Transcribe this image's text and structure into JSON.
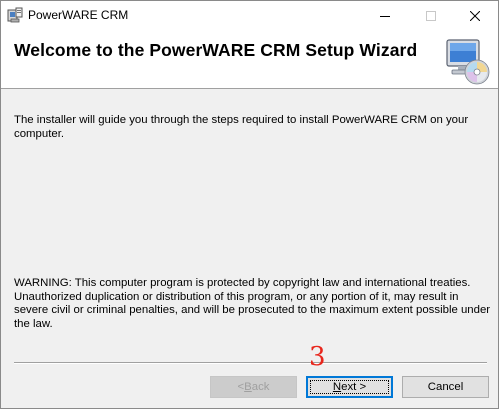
{
  "window": {
    "title": "PowerWARE CRM"
  },
  "banner": {
    "title": "Welcome to the PowerWARE CRM Setup Wizard",
    "icon": "computer-cd-icon"
  },
  "body": {
    "intro": "The installer will guide you through the steps required to install PowerWARE CRM on your computer.",
    "warning": "WARNING: This computer program is protected by copyright law and international treaties. Unauthorized duplication or distribution of this program, or any portion of it, may result in severe civil or criminal penalties, and will be prosecuted to the maximum extent possible under the law."
  },
  "annotation": {
    "step": "3",
    "color": "#e8261c"
  },
  "buttons": {
    "back": {
      "prefix": "< ",
      "accel": "B",
      "rest": "ack",
      "enabled": false
    },
    "next": {
      "accel": "N",
      "rest": "ext >",
      "enabled": true,
      "focused": true
    },
    "cancel": {
      "label": "Cancel",
      "enabled": true
    }
  },
  "colors": {
    "accent": "#0078d7",
    "dialog_bg": "#f0f0f0"
  }
}
